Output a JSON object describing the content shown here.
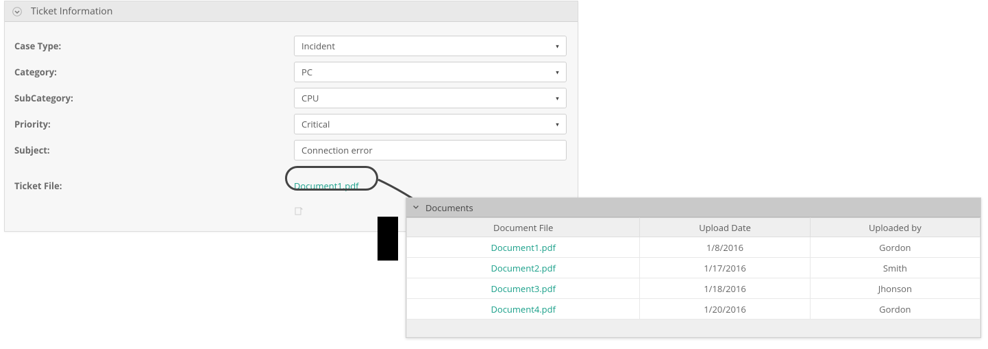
{
  "ticket_panel": {
    "title": "Ticket Information",
    "fields": {
      "case_type_label": "Case Type:",
      "case_type_value": "Incident",
      "category_label": "Category:",
      "category_value": "PC",
      "subcategory_label": "SubCategory:",
      "subcategory_value": "CPU",
      "priority_label": "Priority:",
      "priority_value": "Critical",
      "subject_label": "Subject:",
      "subject_value": "Connection error",
      "ticket_file_label": "Ticket File:",
      "ticket_file_value": "Document1.pdf"
    }
  },
  "documents_panel": {
    "title": "Documents",
    "columns": {
      "file": "Document File",
      "date": "Upload Date",
      "user": "Uploaded by"
    },
    "rows": [
      {
        "file": "Document1.pdf",
        "date": "1/8/2016",
        "user": "Gordon"
      },
      {
        "file": "Document2.pdf",
        "date": "1/17/2016",
        "user": "Smith"
      },
      {
        "file": "Document3.pdf",
        "date": "1/18/2016",
        "user": "Jhonson"
      },
      {
        "file": "Document4.pdf",
        "date": "1/20/2016",
        "user": "Gordon"
      }
    ]
  }
}
